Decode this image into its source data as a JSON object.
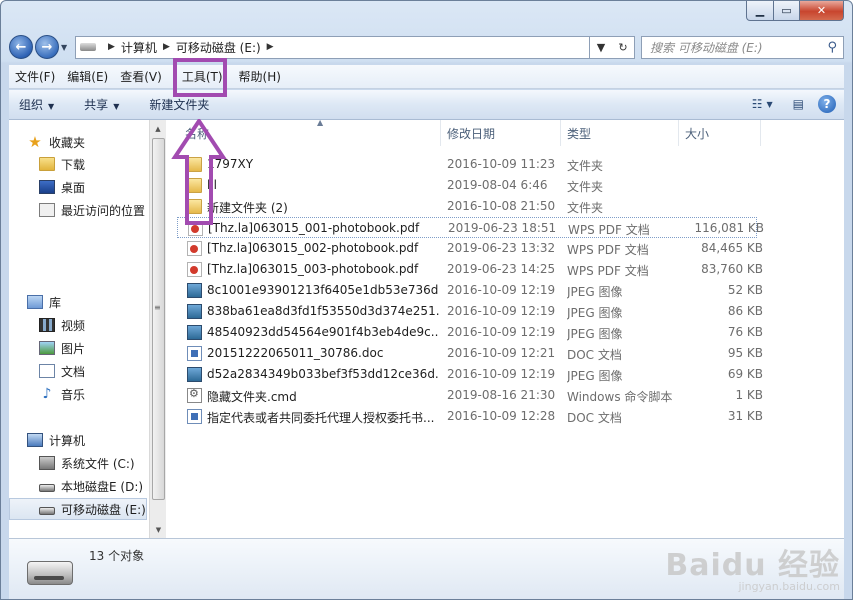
{
  "address": {
    "computer": "计算机",
    "drive": "可移动磁盘 (E:)"
  },
  "search": {
    "placeholder": "搜索 可移动磁盘 (E:)"
  },
  "menu": [
    "文件(F)",
    "编辑(E)",
    "查看(V)",
    "工具(T)",
    "帮助(H)"
  ],
  "toolbar": {
    "organize": "组织",
    "share": "共享",
    "new_folder": "新建文件夹"
  },
  "nav": {
    "favorites": "收藏夹",
    "downloads": "下载",
    "desktop": "桌面",
    "recent": "最近访问的位置",
    "libraries": "库",
    "videos": "视频",
    "pictures": "图片",
    "documents": "文档",
    "music": "音乐",
    "computer": "计算机",
    "drive_c": "系统文件 (C:)",
    "drive_d": "本地磁盘E (D:)",
    "drive_e": "可移动磁盘 (E:)"
  },
  "columns": {
    "name": "名称",
    "date": "修改日期",
    "type": "类型",
    "size": "大小"
  },
  "files": [
    {
      "name": "1797XY",
      "date": "2016-10-09 11:23",
      "type": "文件夹",
      "size": "",
      "icon": "folder"
    },
    {
      "name": "lll",
      "date": "2019-08-04 6:46",
      "type": "文件夹",
      "size": "",
      "icon": "folder"
    },
    {
      "name": "新建文件夹 (2)",
      "date": "2016-10-08 21:50",
      "type": "文件夹",
      "size": "",
      "icon": "folder"
    },
    {
      "name": "[Thz.la]063015_001-photobook.pdf",
      "date": "2019-06-23 18:51",
      "type": "WPS PDF 文档",
      "size": "116,081 KB",
      "icon": "pdf"
    },
    {
      "name": "[Thz.la]063015_002-photobook.pdf",
      "date": "2019-06-23 13:32",
      "type": "WPS PDF 文档",
      "size": "84,465 KB",
      "icon": "pdf"
    },
    {
      "name": "[Thz.la]063015_003-photobook.pdf",
      "date": "2019-06-23 14:25",
      "type": "WPS PDF 文档",
      "size": "83,760 KB",
      "icon": "pdf"
    },
    {
      "name": "8c1001e93901213f6405e1db53e736d...",
      "date": "2016-10-09 12:19",
      "type": "JPEG 图像",
      "size": "52 KB",
      "icon": "jpeg"
    },
    {
      "name": "838ba61ea8d3fd1f53550d3d374e251...",
      "date": "2016-10-09 12:19",
      "type": "JPEG 图像",
      "size": "86 KB",
      "icon": "jpeg"
    },
    {
      "name": "48540923dd54564e901f4b3eb4de9c...",
      "date": "2016-10-09 12:19",
      "type": "JPEG 图像",
      "size": "76 KB",
      "icon": "jpeg"
    },
    {
      "name": "20151222065011_30786.doc",
      "date": "2016-10-09 12:21",
      "type": "DOC 文档",
      "size": "95 KB",
      "icon": "doc"
    },
    {
      "name": "d52a2834349b033bef3f53dd12ce36d...",
      "date": "2016-10-09 12:19",
      "type": "JPEG 图像",
      "size": "69 KB",
      "icon": "jpeg"
    },
    {
      "name": "隐藏文件夹.cmd",
      "date": "2019-08-16 21:30",
      "type": "Windows 命令脚本",
      "size": "1 KB",
      "icon": "cmd"
    },
    {
      "name": "指定代表或者共同委托代理人授权委托书...",
      "date": "2016-10-09 12:28",
      "type": "DOC 文档",
      "size": "31 KB",
      "icon": "doc"
    }
  ],
  "status": {
    "count": "13 个对象"
  },
  "watermark": {
    "brand": "Baidu 经验",
    "url": "jingyan.baidu.com"
  },
  "colors": {
    "annotation": "#a24bb0"
  }
}
